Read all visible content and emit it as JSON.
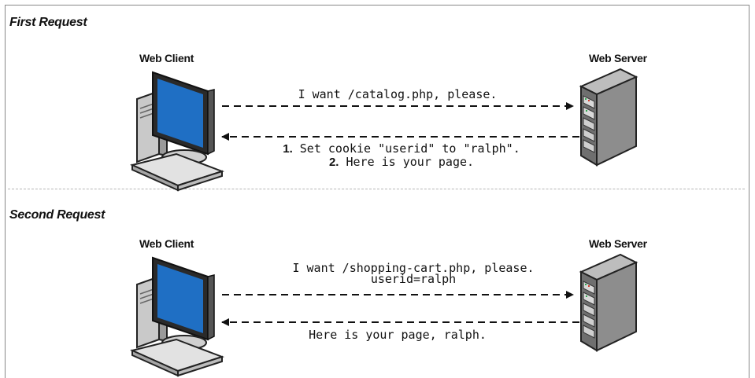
{
  "sections": [
    {
      "title": "First Request",
      "client_label": "Web Client",
      "server_label": "Web Server",
      "request_lines": [
        "I want /catalog.php, please."
      ],
      "response_steps": [
        {
          "num": "1.",
          "text": "Set cookie \"userid\" to \"ralph\"."
        },
        {
          "num": "2.",
          "text": "Here is your page."
        }
      ]
    },
    {
      "title": "Second Request",
      "client_label": "Web Client",
      "server_label": "Web Server",
      "request_lines": [
        "I want /shopping-cart.php, please.",
        "userid=ralph"
      ],
      "response_text": "Here is your page, ralph."
    }
  ],
  "icons": {
    "client": "desktop-computer-icon",
    "server": "server-tower-icon"
  },
  "colors": {
    "monitor_screen": "#1f6fc4",
    "monitor_frame": "#2a2a2a",
    "server_body": "#8d8d8d",
    "separator": "#b5b5b5"
  }
}
